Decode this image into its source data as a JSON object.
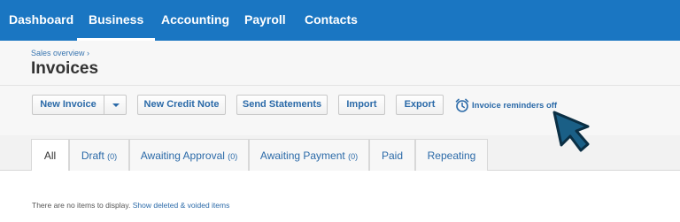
{
  "topnav": {
    "items": [
      {
        "label": "Dashboard"
      },
      {
        "label": "Business",
        "active": true
      },
      {
        "label": "Accounting"
      },
      {
        "label": "Payroll"
      },
      {
        "label": "Contacts"
      }
    ]
  },
  "header": {
    "breadcrumb": "Sales overview ›",
    "title": "Invoices"
  },
  "toolbar": {
    "new_invoice": "New Invoice",
    "new_credit_note": "New Credit Note",
    "send_statements": "Send Statements",
    "import": "Import",
    "export": "Export",
    "reminders": "Invoice reminders off"
  },
  "tabs": [
    {
      "label": "All",
      "count": "",
      "active": true
    },
    {
      "label": "Draft",
      "count": "(0)"
    },
    {
      "label": "Awaiting Approval",
      "count": "(0)"
    },
    {
      "label": "Awaiting Payment",
      "count": "(0)"
    },
    {
      "label": "Paid",
      "count": ""
    },
    {
      "label": "Repeating",
      "count": ""
    }
  ],
  "empty_state": {
    "message": "There are no items to display.",
    "link": "Show deleted & voided items"
  },
  "colors": {
    "brand": "#1a76c2",
    "link": "#2b6aa8",
    "cursor": "#1a5f86"
  }
}
